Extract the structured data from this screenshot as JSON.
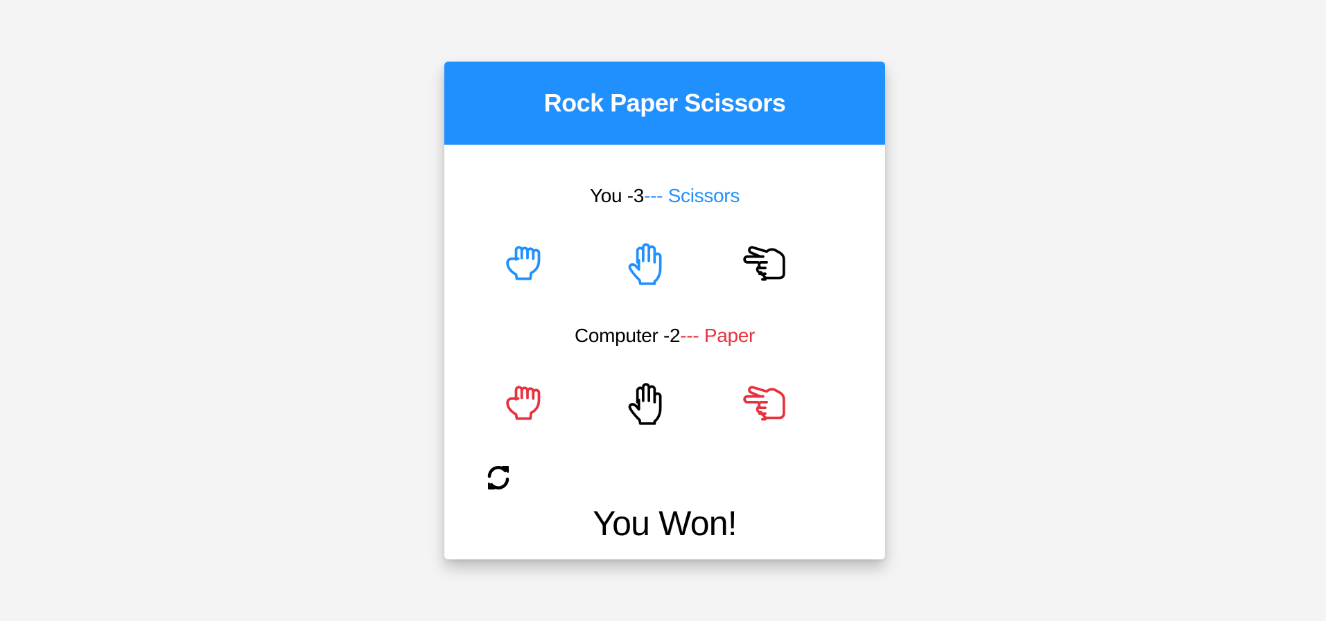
{
  "title": "Rock Paper Scissors",
  "colors": {
    "brand": "#2090fe",
    "you": "#2090fe",
    "computer": "#e8313e",
    "selected": "#000000"
  },
  "player": {
    "label": "You -",
    "score": "3",
    "sep": "--- ",
    "choice": "Scissors",
    "hands": [
      {
        "name": "rock",
        "icon": "hand-rock-icon",
        "selected": false
      },
      {
        "name": "paper",
        "icon": "hand-paper-icon",
        "selected": false
      },
      {
        "name": "scissors",
        "icon": "hand-scissors-icon",
        "selected": true
      }
    ]
  },
  "computer": {
    "label": "Computer -",
    "score": "2",
    "sep": "--- ",
    "choice": "Paper",
    "hands": [
      {
        "name": "rock",
        "icon": "hand-rock-icon",
        "selected": false
      },
      {
        "name": "paper",
        "icon": "hand-paper-icon",
        "selected": true
      },
      {
        "name": "scissors",
        "icon": "hand-scissors-icon",
        "selected": false
      }
    ]
  },
  "reset_icon": "sync-icon",
  "result": "You Won!"
}
